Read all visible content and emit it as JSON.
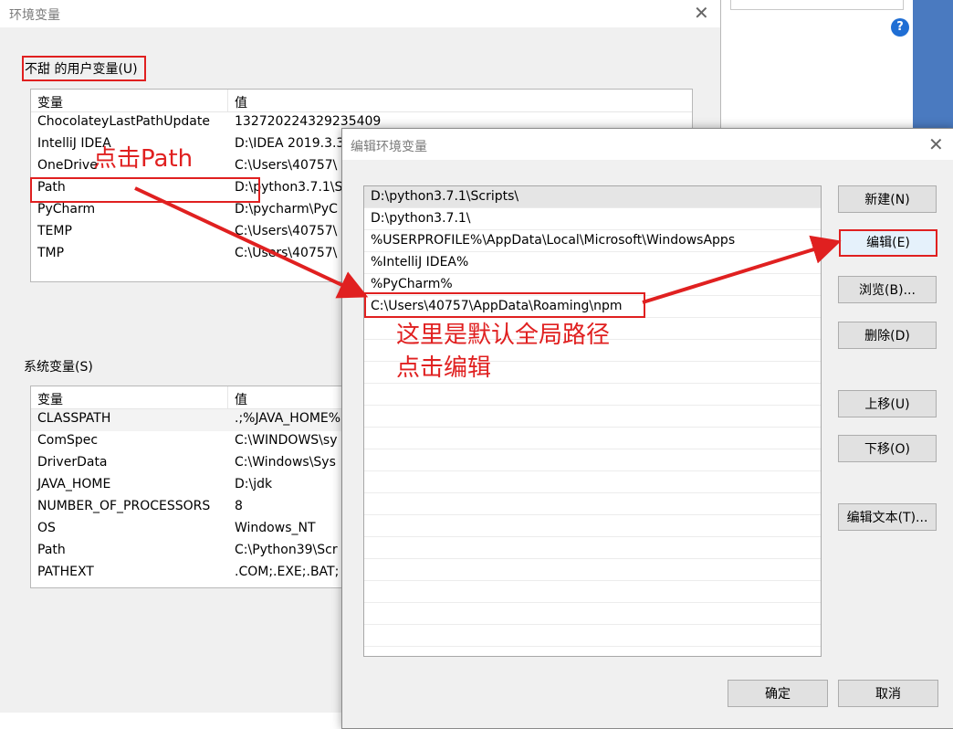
{
  "bg": {
    "help": "?"
  },
  "env_dialog": {
    "title": "环境变量",
    "user_group_label": "不甜 的用户变量(U)",
    "system_group_label": "系统变量(S)",
    "col_var": "变量",
    "col_val": "值",
    "user_vars": [
      {
        "name": "ChocolateyLastPathUpdate",
        "value": "132720224329235409"
      },
      {
        "name": "IntelliJ IDEA",
        "value": "D:\\IDEA 2019.3.3"
      },
      {
        "name": "OneDrive",
        "value": "C:\\Users\\40757\\"
      },
      {
        "name": "Path",
        "value": "D:\\python3.7.1\\S"
      },
      {
        "name": "PyCharm",
        "value": "D:\\pycharm\\PyC"
      },
      {
        "name": "TEMP",
        "value": "C:\\Users\\40757\\"
      },
      {
        "name": "TMP",
        "value": "C:\\Users\\40757\\"
      }
    ],
    "system_vars": [
      {
        "name": "CLASSPATH",
        "value": ".;%JAVA_HOME%"
      },
      {
        "name": "ComSpec",
        "value": "C:\\WINDOWS\\sy"
      },
      {
        "name": "DriverData",
        "value": "C:\\Windows\\Sys"
      },
      {
        "name": "JAVA_HOME",
        "value": "D:\\jdk"
      },
      {
        "name": "NUMBER_OF_PROCESSORS",
        "value": "8"
      },
      {
        "name": "OS",
        "value": "Windows_NT"
      },
      {
        "name": "Path",
        "value": "C:\\Python39\\Scr"
      },
      {
        "name": "PATHEXT",
        "value": ".COM;.EXE;.BAT;"
      }
    ]
  },
  "edit_dialog": {
    "title": "编辑环境变量",
    "paths": [
      "D:\\python3.7.1\\Scripts\\",
      "D:\\python3.7.1\\",
      "%USERPROFILE%\\AppData\\Local\\Microsoft\\WindowsApps",
      "%IntelliJ IDEA%",
      "%PyCharm%",
      "C:\\Users\\40757\\AppData\\Roaming\\npm"
    ],
    "buttons": {
      "new": "新建(N)",
      "edit": "编辑(E)",
      "browse": "浏览(B)...",
      "delete": "删除(D)",
      "up": "上移(U)",
      "down": "下移(O)",
      "edit_text": "编辑文本(T)...",
      "ok": "确定",
      "cancel": "取消"
    }
  },
  "annotations": {
    "click_path": "点击Path",
    "note_line1": "这里是默认全局路径",
    "note_line2": "点击编辑"
  },
  "colors": {
    "annotation": "#e02020"
  }
}
